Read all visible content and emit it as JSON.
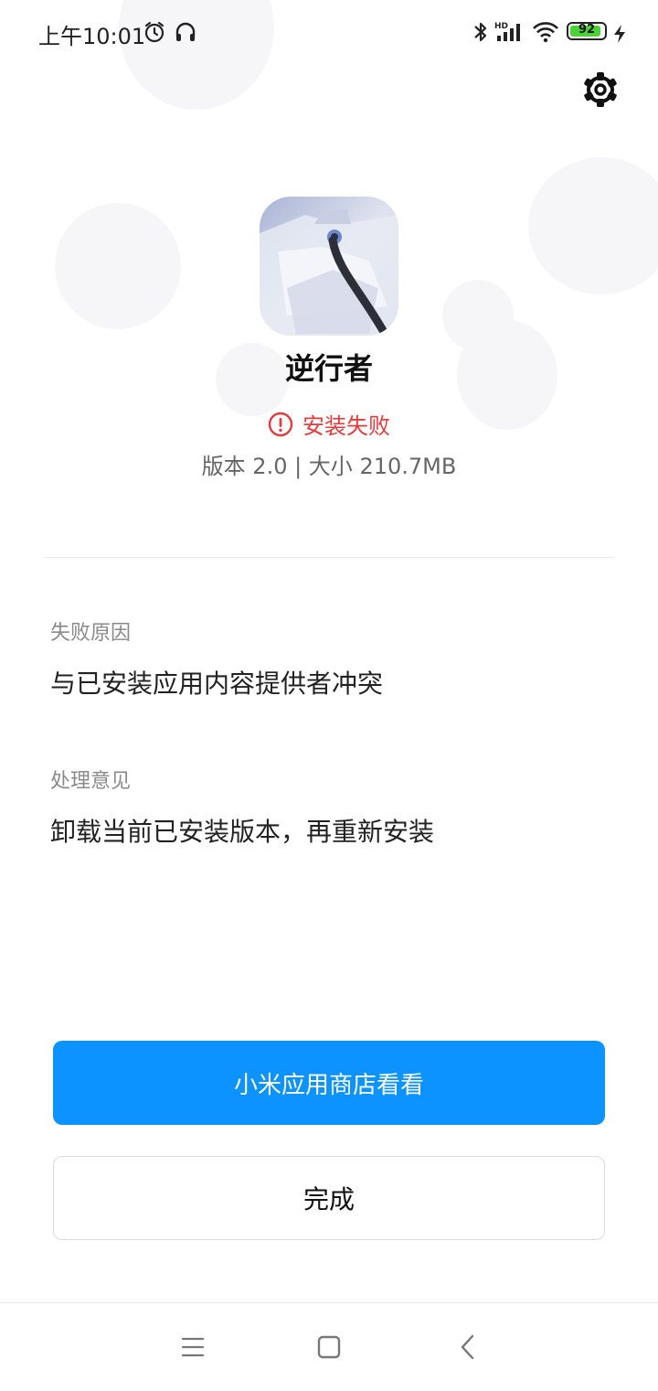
{
  "status_bar": {
    "time": "上午10:01",
    "icons": [
      "alarm-icon",
      "headset-icon",
      "bluetooth-icon",
      "hd-signal-icon",
      "wifi-icon",
      "battery-icon",
      "charging-icon"
    ],
    "battery_level": "92",
    "battery_percent": 92,
    "hd_label": "HD"
  },
  "header": {
    "settings_icon": "gear-icon"
  },
  "app": {
    "name": "逆行者",
    "install_status": "安装失败",
    "version_info": "版本 2.0 | 大小 210.7MB"
  },
  "details": {
    "reason_label": "失败原因",
    "reason_value": "与已安装应用内容提供者冲突",
    "advice_label": "处理意见",
    "advice_value": "卸载当前已安装版本，再重新安装"
  },
  "actions": {
    "primary_label": "小米应用商店看看",
    "secondary_label": "完成"
  },
  "nav": {
    "icons": [
      "menu-icon",
      "home-icon",
      "back-icon"
    ]
  },
  "colors": {
    "primary": "#0d93ff",
    "error": "#e23c3c"
  }
}
